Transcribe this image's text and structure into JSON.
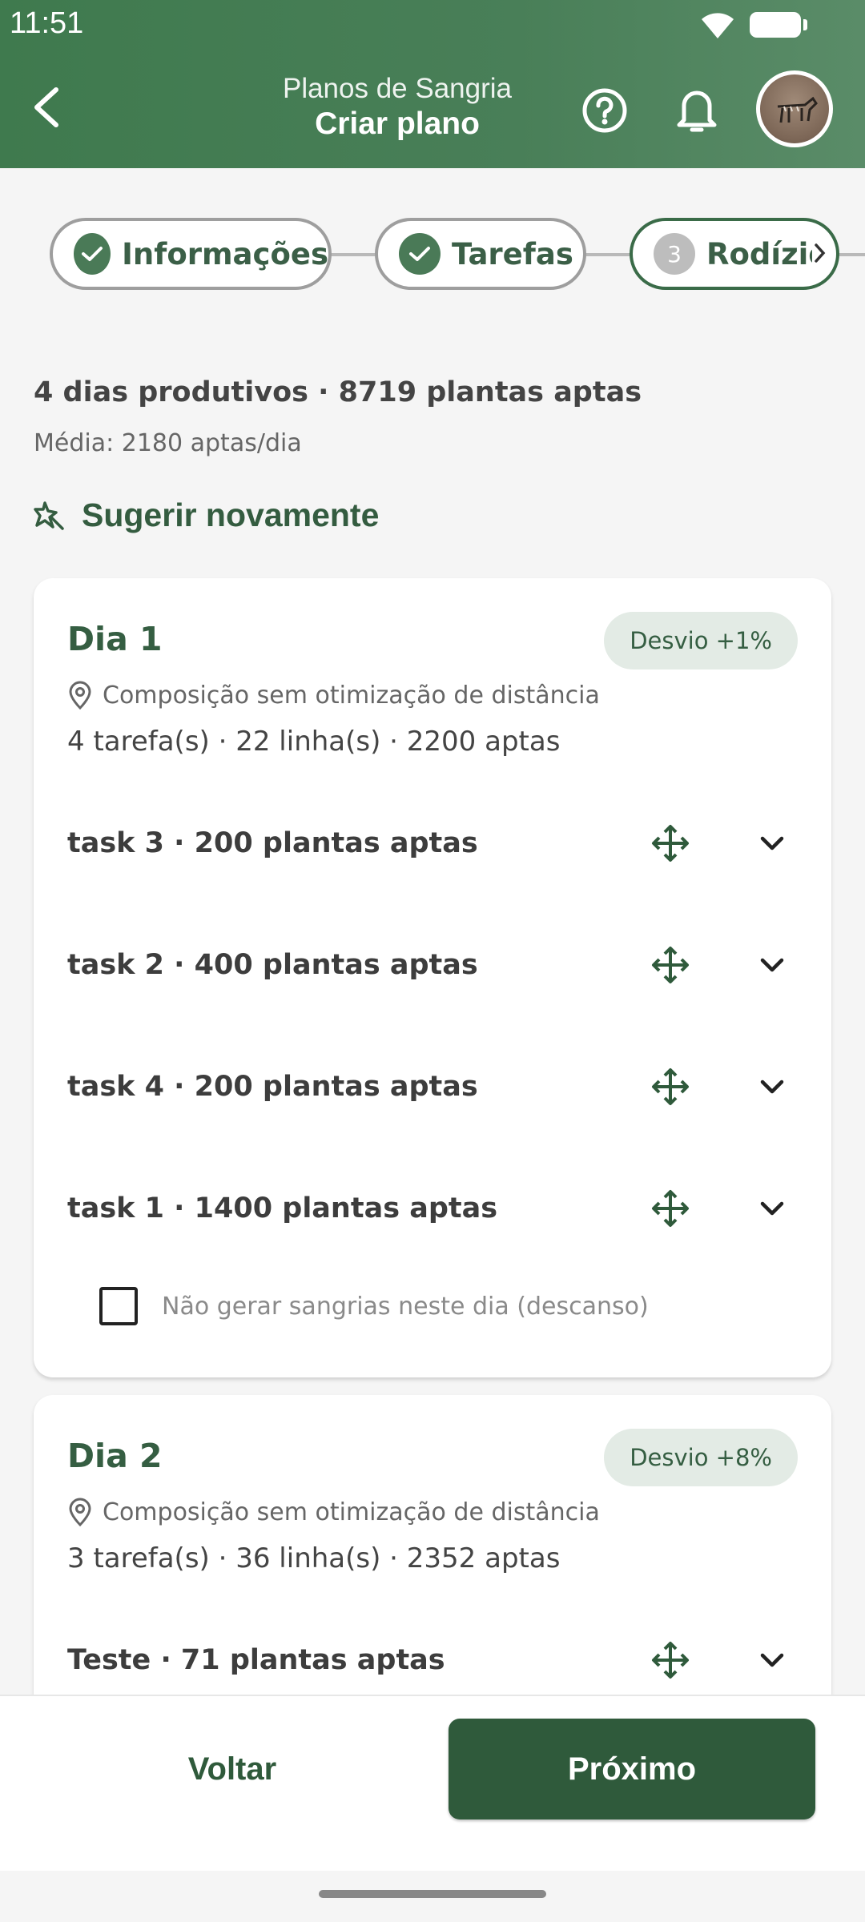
{
  "status_bar": {
    "time": "11:51"
  },
  "header": {
    "supertitle": "Planos de Sangria",
    "title": "Criar plano"
  },
  "stepper": {
    "steps": [
      {
        "label": "Informações",
        "state": "done"
      },
      {
        "label": "Tarefas",
        "state": "done"
      },
      {
        "number": "3",
        "label": "Rodízio",
        "state": "active"
      }
    ]
  },
  "summary": {
    "title": "4 dias produtivos · 8719 plantas aptas",
    "subtitle": "Média: 2180 aptas/dia",
    "suggest_label": "Sugerir novamente"
  },
  "days": [
    {
      "title": "Dia 1",
      "badge": "Desvio +1%",
      "meta": "Composição sem otimização de distância",
      "stats": "4 tarefa(s) · 22 linha(s) · 2200 aptas",
      "tasks": [
        "task 3 · 200 plantas aptas",
        "task 2 · 400 plantas aptas",
        "task 4 · 200 plantas aptas",
        "task 1 · 1400 plantas aptas"
      ],
      "rest_label": "Não gerar sangrias neste dia (descanso)",
      "rest_checked": false
    },
    {
      "title": "Dia 2",
      "badge": "Desvio +8%",
      "meta": "Composição sem otimização de distância",
      "stats": "3 tarefa(s) · 36 linha(s) · 2352 aptas",
      "tasks": [
        "Teste · 71 plantas aptas"
      ]
    }
  ],
  "footer": {
    "back_label": "Voltar",
    "next_label": "Próximo"
  },
  "colors": {
    "primary": "#2f5a3b",
    "header": "#497f58",
    "badge_bg": "#e3ebe5"
  }
}
